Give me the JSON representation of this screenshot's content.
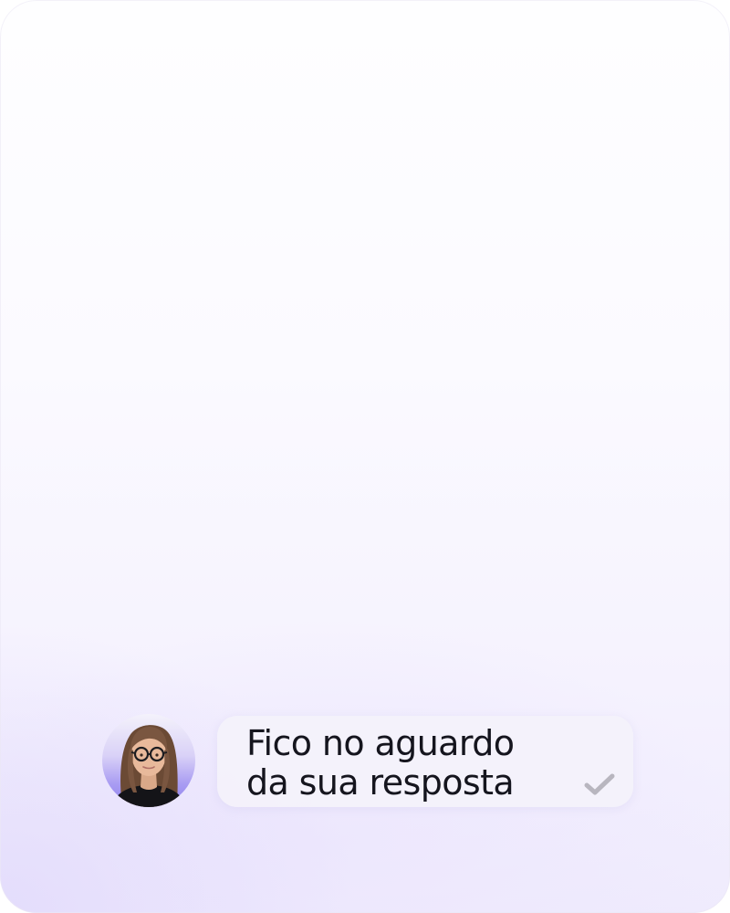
{
  "chat": {
    "message": {
      "lines": [
        "Fico no aguardo",
        "da sua resposta"
      ],
      "status_icon": "check-icon"
    },
    "avatar": {
      "icon": "person-avatar"
    }
  },
  "colors": {
    "text": "#15151e",
    "bubble": "#f4f2fb",
    "avatar_gradient_end": "#8f82ee",
    "check": "#b8b6bf"
  }
}
